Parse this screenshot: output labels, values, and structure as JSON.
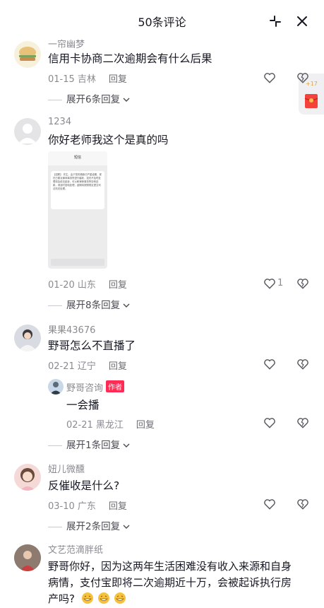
{
  "header": {
    "title": "50条评论"
  },
  "comments": [
    {
      "user": "一帘幽梦",
      "text": "信用卡协商二次逾期会有什么后果",
      "date_loc": "01-15 吉林",
      "reply": "回复",
      "expand": "展开6条回复"
    },
    {
      "user": "1234",
      "text": "你好老师我这个是真的吗",
      "date_loc": "01-20 山东",
      "reply": "回复",
      "likes": "1",
      "expand": "展开8条回复",
      "shot": {
        "title": "短信",
        "body": "【招联】 先生，由于您的借款已严重逾期，现在已委派律师事务所进行催收，如仍不及时处理将会依法起诉，可以和律师事务所协商还款，请及时回电处理，逾期将按照规定提交司法机关处理。"
      }
    },
    {
      "user": "果果43676",
      "text": "野哥怎么不直播了",
      "date_loc": "02-21 辽宁",
      "reply": "回复",
      "sub": {
        "user": "野哥咨询",
        "badge": "作者",
        "text": "一会播",
        "date_loc": "02-21 黑龙江",
        "reply": "回复"
      },
      "expand": "展开1条回复"
    },
    {
      "user": "妞儿微醺",
      "text": "反催收是什么?",
      "date_loc": "03-10 广东",
      "reply": "回复",
      "expand": "展开2条回复"
    },
    {
      "user": "文艺范滴胖纸",
      "text_line1": "野哥你好，因为这两年生活困难没有收入来源和自身",
      "text_line2": "病情，支付宝即将二次逾期近十万，会被起诉执行房",
      "text_line3": "产吗?"
    }
  ],
  "side_widget": {
    "label": "+17"
  },
  "colors": {
    "accent": "#fe2c55",
    "text": "#161823",
    "secondary": "#8a8b91"
  },
  "icons": [
    "minimize-icon",
    "close-icon",
    "heart-outline-icon",
    "broken-heart-icon",
    "chevron-down-icon",
    "red-envelope-icon",
    "grin-emoji-icon"
  ]
}
